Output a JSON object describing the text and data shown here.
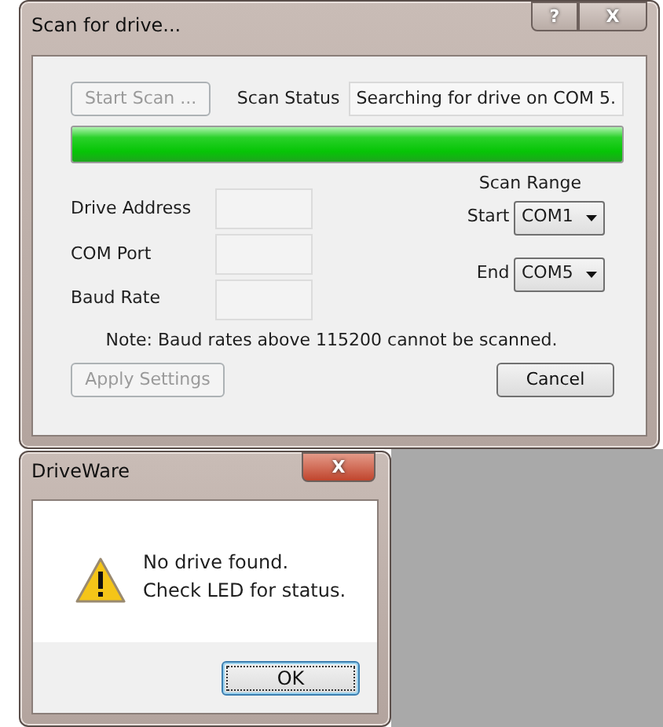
{
  "window": {
    "title": "Scan for drive...",
    "help_button": "?",
    "close_button": "X"
  },
  "scan": {
    "start_button": {
      "label": "Start Scan ...",
      "disabled": true
    },
    "status_label": "Scan Status",
    "status_value": "Searching for drive on COM 5.",
    "progress": {
      "level": 1
    }
  },
  "settings": [
    {
      "label": "Drive Address"
    },
    {
      "label": "COM Port"
    },
    {
      "label": "Baud Rate"
    }
  ],
  "scan_range": {
    "title": "Scan Range",
    "start": {
      "label": "Start",
      "value": "COM1"
    },
    "end": {
      "label": "End",
      "value": "COM5"
    }
  },
  "note": "Note: Baud rates above 115200 cannot be scanned.",
  "buttons": [
    {
      "label": "Apply Settings",
      "disabled": true
    },
    {
      "label": "Cancel",
      "disabled": false
    }
  ],
  "dialog": {
    "title": "DriveWare",
    "close_button": "X",
    "message": [
      "No drive found.",
      "Check LED for status."
    ],
    "ok_button": {
      "label": "OK",
      "focused": true
    }
  }
}
